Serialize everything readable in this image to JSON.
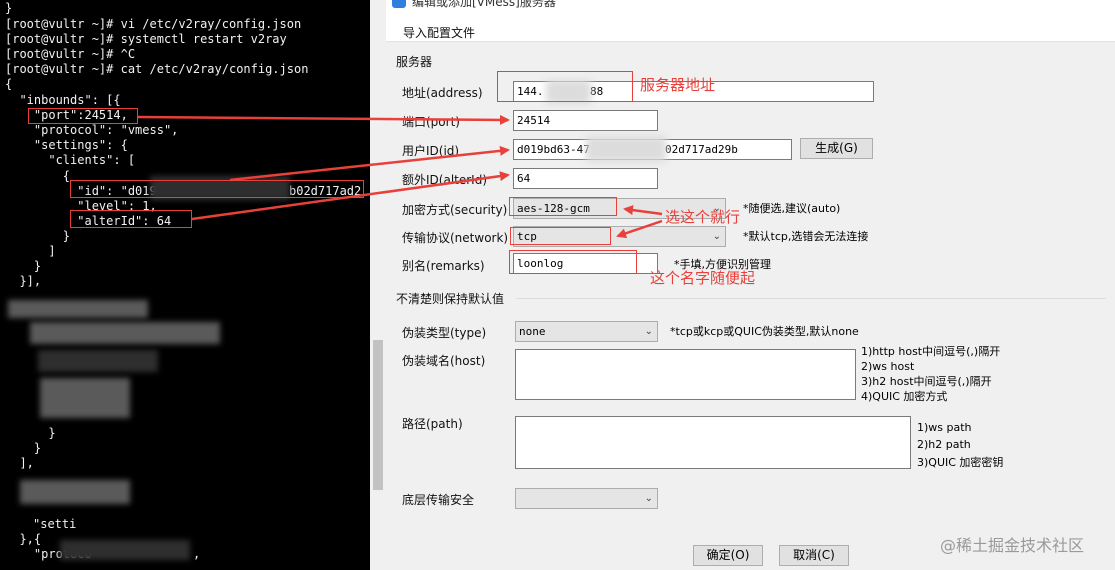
{
  "terminal": {
    "lines": [
      "}",
      "[root@vultr ~]# vi /etc/v2ray/config.json",
      "[root@vultr ~]# systemctl restart v2ray",
      "[root@vultr ~]# ^C",
      "[root@vultr ~]# cat /etc/v2ray/config.json",
      "{",
      "  \"inbounds\": [{",
      "    \"port\":24514,",
      "    \"protocol\": \"vmess\",",
      "    \"settings\": {",
      "      \"clients\": [",
      "        {",
      "          \"id\": \"d019",
      "          \"level\": 1,",
      "          \"alterId\": 64",
      "        }",
      "      ]",
      "    }",
      "  }],",
      "      }",
      "    }",
      "  ],",
      "  },{",
      "    \"protoco"
    ],
    "id_tail": "b02d717ad2",
    "frag_settings": "\"setti",
    "frag_comma": ","
  },
  "dialog": {
    "title": "编辑或添加[VMess]服务器",
    "menu_import": "导入配置文件",
    "section_server": "服务器",
    "address_label": "地址(address)",
    "address_prefix": "144.",
    "address_suffix": "88",
    "port_label": "端口(port)",
    "port_value": "24514",
    "id_label": "用户ID(id)",
    "id_prefix": "d019bd63-47",
    "id_suffix": "02d717ad29b",
    "generate_button": "生成(G)",
    "alterid_label": "额外ID(alterId)",
    "alterid_value": "64",
    "security_label": "加密方式(security)",
    "security_value": "aes-128-gcm",
    "security_hint": "*随便选,建议(auto)",
    "network_label": "传输协议(network)",
    "network_value": "tcp",
    "network_hint": "*默认tcp,选错会无法连接",
    "remarks_label": "别名(remarks)",
    "remarks_value": "loonlog",
    "remarks_hint": "*手填,方便识别管理",
    "section_default": "不清楚则保持默认值",
    "type_label": "伪装类型(type)",
    "type_value": "none",
    "type_hint": "*tcp或kcp或QUIC伪装类型,默认none",
    "host_label": "伪装域名(host)",
    "host_hints": [
      "1)http host中间逗号(,)隔开",
      "2)ws host",
      "3)h2 host中间逗号(,)隔开",
      "4)QUIC 加密方式"
    ],
    "path_label": "路径(path)",
    "path_hints": [
      "1)ws path",
      "2)h2 path",
      "3)QUIC 加密密钥"
    ],
    "tls_label": "底层传输安全",
    "ok_button": "确定(O)",
    "cancel_button": "取消(C)"
  },
  "annotations": {
    "server_address": "服务器地址",
    "choose_this": "选这个就行",
    "any_name": "这个名字随便起"
  },
  "watermark": "@稀土掘金技术社区",
  "colors": {
    "annotation_red": "#e8403a",
    "terminal_bg": "#000000",
    "dialog_bg": "#f0f0f0"
  }
}
